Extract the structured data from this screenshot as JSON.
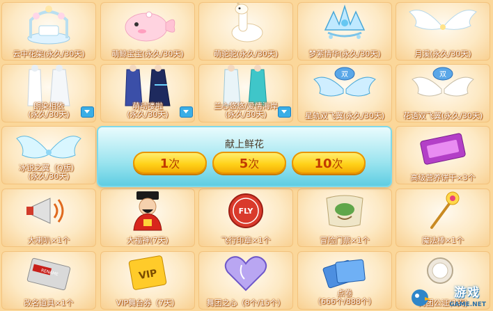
{
  "items": [
    {
      "label": "云中花架(永久/30天)",
      "icon": "cloud-flower-trellis-icon"
    },
    {
      "label": "萌鲸宝宝(永久/30天)",
      "icon": "pink-whale-pet-icon"
    },
    {
      "label": "萌驼驼(永久/30天)",
      "icon": "white-alpaca-pet-icon"
    },
    {
      "label": "梦萦情华(永久/30天)",
      "icon": "crystal-crown-icon"
    },
    {
      "label": "月溪(永久/30天)",
      "icon": "white-wings-icon"
    },
    {
      "label_line1": "朗染相依",
      "label_line2": "(永久/30天)",
      "icon": "white-outfit-pair-icon",
      "has_dropdown": true
    },
    {
      "label_line1": "萌动喽啦",
      "label_line2": "(永久/30天)",
      "icon": "blue-outfit-pair-icon",
      "has_dropdown": true
    },
    {
      "label_line1": "兰心悠悠/爱情海岸",
      "label_line2": "(永久/30天)",
      "icon": "cyan-outfit-pair-icon",
      "has_dropdown": true
    },
    {
      "label": "星轨双飞翼(永久/30天)",
      "icon": "blue-double-wings-icon"
    },
    {
      "label": "花语双飞翼(永久/30天)",
      "icon": "flower-double-wings-icon"
    },
    {
      "label_line1": "冰锐之翼（Q版）",
      "label_line2": "(永久/30天)",
      "icon": "ice-wings-icon"
    },
    {
      "label": "高级营养饼干×3个",
      "icon": "ticket-biscuit-icon"
    },
    {
      "label": "大喇叭×1个",
      "icon": "megaphone-icon"
    },
    {
      "label": "大福神(7天)",
      "icon": "fortune-god-icon"
    },
    {
      "label": "飞行印章×1个",
      "icon": "flight-stamp-icon"
    },
    {
      "label": "冒险门票×1个",
      "icon": "adventure-ticket-icon"
    },
    {
      "label": "魔法棒×1个",
      "icon": "magic-wand-icon"
    },
    {
      "label": "改名道具×1个",
      "icon": "rename-card-icon"
    },
    {
      "label": "VIP舞台券（7天）",
      "icon": "vip-ticket-icon"
    },
    {
      "label": "舞团之心（8个/15个）",
      "icon": "crystal-heart-icon"
    },
    {
      "label_line1": "点卷",
      "label_line2": "（666个/888个）",
      "icon": "point-cards-icon"
    },
    {
      "label": "舞团公证(1天)",
      "icon": "guild-medal-icon"
    }
  ],
  "popup": {
    "title": "献上鲜花",
    "buttons": [
      {
        "num": "1",
        "unit": "次"
      },
      {
        "num": "5",
        "unit": "次"
      },
      {
        "num": "10",
        "unit": "次"
      }
    ]
  },
  "watermark": {
    "text": "游戏",
    "sub": "GAME.NET"
  },
  "colors": {
    "background": "#fbd79a",
    "popup": "#9be4ef",
    "button": "#ffd21a",
    "label_outline": "#b55d12"
  }
}
